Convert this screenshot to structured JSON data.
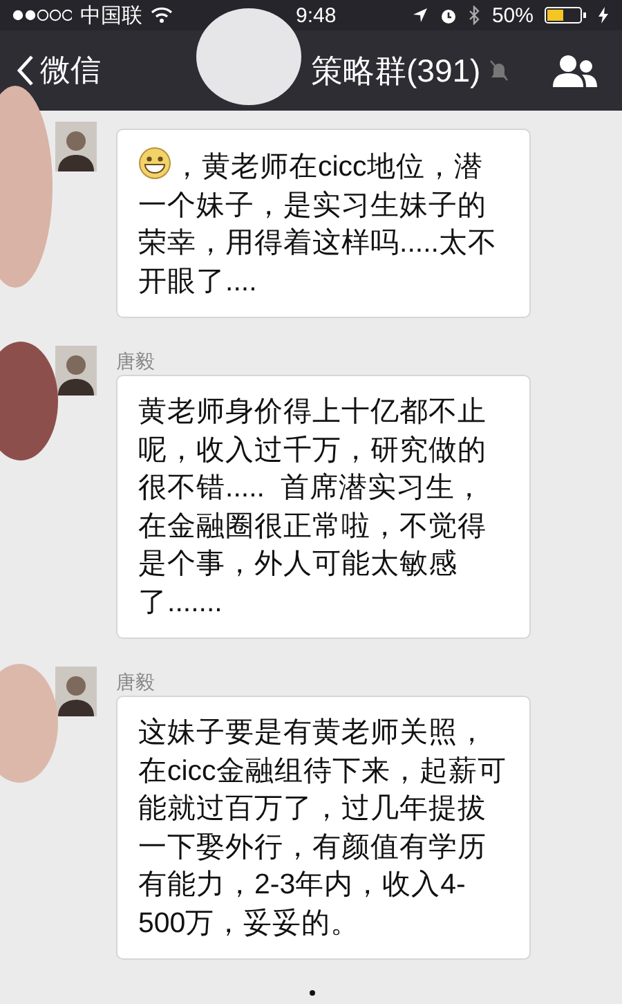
{
  "status_bar": {
    "carrier": "中国联",
    "time": "9:48",
    "battery": "50%",
    "charging": true
  },
  "nav": {
    "back": "微信",
    "title": "策略群(391)",
    "muted": true
  },
  "messages": [
    {
      "emoji": true,
      "text": "，黄老师在cicc地位，潜一个妹子，是实习生妹子的荣幸，用得着这样吗.....太不开眼了...."
    },
    {
      "sender": "唐毅",
      "emoji": false,
      "text": "黄老师身价得上十亿都不止呢，收入过千万，研究做的很不错.....  首席潜实习生，在金融圈很正常啦，不觉得是个事，外人可能太敏感了......."
    },
    {
      "sender": "唐毅",
      "emoji": false,
      "text": "这妹子要是有黄老师关照，在cicc金融组待下来，起薪可能就过百万了，过几年提拔一下娶外行，有颜值有学历有能力，2-3年内，收入4-500万，妥妥的。"
    }
  ]
}
